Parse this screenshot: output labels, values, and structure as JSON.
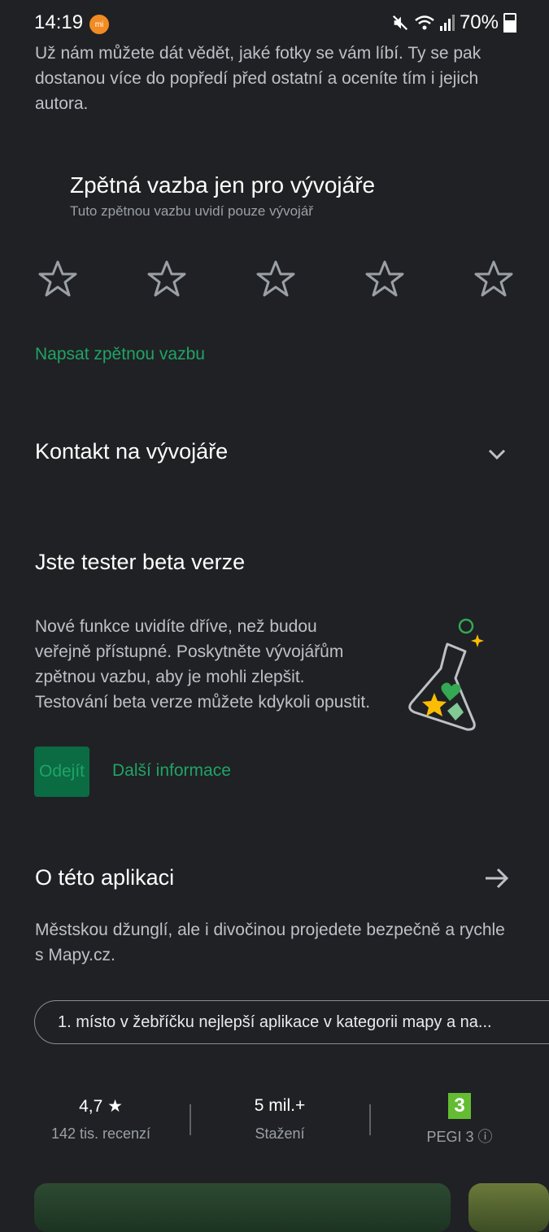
{
  "status_bar": {
    "time": "14:19",
    "mi_badge": "mi",
    "battery": "70%"
  },
  "intro_text": "Už nám můžete dát vědět, jaké fotky se vám líbí. Ty se pak dostanou více do popředí před ostatní a oceníte tím i jejich autora.",
  "developer_feedback": {
    "title": "Zpětná vazba jen pro vývojáře",
    "subtitle": "Tuto zpětnou vazbu uvidí pouze vývojář",
    "rating": 0,
    "max_rating": 5,
    "write_link": "Napsat zpětnou vazbu"
  },
  "contact": {
    "title": "Kontakt na vývojáře"
  },
  "beta": {
    "title": "Jste tester beta verze",
    "text": "Nové funkce uvidíte dříve, než budou veřejně přístupné. Poskytněte vývojářům zpětnou vazbu, aby je mohli zlepšit. Testování beta verze můžete kdykoli opustit.",
    "leave_button": "Odejít",
    "more_link": "Další informace"
  },
  "about": {
    "title": "O této aplikaci",
    "description": "Městskou džunglí, ale i divočinou projedete bezpečně a rychle s Mapy.cz.",
    "chip": "1. místo v žebříčku nejlepší aplikace v kategorii mapy a na..."
  },
  "stats": {
    "rating_value": "4,7",
    "rating_label": "142 tis. recenzí",
    "downloads_value": "5 mil.+",
    "downloads_label": "Stažení",
    "pegi_number": "3",
    "pegi_label": "PEGI 3"
  },
  "colors": {
    "accent": "#1fa466",
    "background": "#202124",
    "pegi_green": "#64bc33"
  }
}
